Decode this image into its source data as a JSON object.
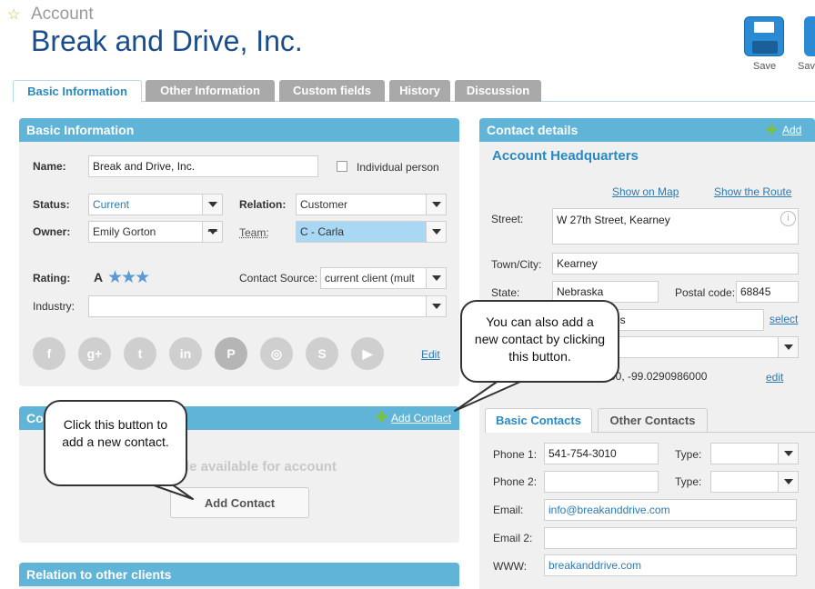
{
  "header": {
    "crumb": "Account",
    "title": "Break and Drive, Inc.",
    "save_label": "Save",
    "save2_label": "Save"
  },
  "tabs": [
    "Basic Information",
    "Other Information",
    "Custom fields",
    "History",
    "Discussion"
  ],
  "basic": {
    "title": "Basic Information",
    "name_label": "Name:",
    "name_value": "Break and Drive, Inc.",
    "individual_label": "Individual person",
    "status_label": "Status:",
    "status_value": "Current",
    "relation_label": "Relation:",
    "relation_value": "Customer",
    "owner_label": "Owner:",
    "owner_value": "Emily Gorton",
    "team_label": "Team:",
    "team_value": "C - Carla",
    "rating_label": "Rating:",
    "rating_value": "A",
    "source_label": "Contact Source:",
    "source_value": "current client (mult",
    "industry_label": "Industry:",
    "edit_label": "Edit",
    "socials": [
      {
        "icon": "facebook-icon",
        "glyph": "f"
      },
      {
        "icon": "google-plus-icon",
        "glyph": "g+"
      },
      {
        "icon": "twitter-icon",
        "glyph": "t"
      },
      {
        "icon": "linkedin-icon",
        "glyph": "in"
      },
      {
        "icon": "pinterest-icon",
        "glyph": "P"
      },
      {
        "icon": "instagram-icon",
        "glyph": "◎"
      },
      {
        "icon": "skype-icon",
        "glyph": "S"
      },
      {
        "icon": "youtube-icon",
        "glyph": "▶"
      }
    ]
  },
  "contacts": {
    "title_fragment": "Co",
    "add_label": "Add Contact",
    "empty_fragment": "le available for account",
    "button_label": "Add Contact"
  },
  "relation": {
    "title": "Relation to other clients"
  },
  "details": {
    "title": "Contact details",
    "add_label": "Add",
    "hq": "Account Headquarters",
    "show_map": "Show on Map",
    "show_route": "Show the Route",
    "street_label": "Street:",
    "street_value": "W 27th Street, Kearney",
    "town_label": "Town/City:",
    "town_value": "Kearney",
    "state_label": "State:",
    "state_value": "Nebraska",
    "postal_label": "Postal code:",
    "postal_value": "68845",
    "country_fragment": "es",
    "select_label": "select",
    "gps_fragment": "00, -99.0290986000",
    "edit_label": "edit"
  },
  "contact_tabs": [
    "Basic Contacts",
    "Other Contacts"
  ],
  "basic_contacts": {
    "phone1_label": "Phone 1:",
    "phone1_value": "541-754-3010",
    "phone2_label": "Phone 2:",
    "phone2_value": "",
    "type_label": "Type:",
    "email_label": "Email:",
    "email_value": "info@breakanddrive.com",
    "email2_label": "Email 2:",
    "email2_value": "",
    "www_label": "WWW:",
    "www_value": "breakanddrive.com"
  },
  "callouts": {
    "left": "Click this button to add a new contact.",
    "right": "You can also add a new contact by clicking this button."
  },
  "colors": {
    "accent": "#5fb4d8",
    "title": "#1a4d8c",
    "link": "#2a7ab8"
  }
}
